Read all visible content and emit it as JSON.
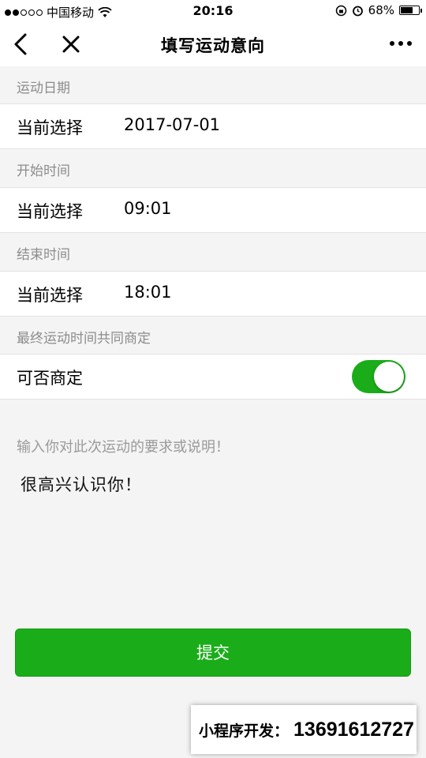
{
  "status_bar": {
    "carrier": "中国移动",
    "time": "20:16",
    "battery_percent_label": "68%",
    "battery_level": 0.68
  },
  "nav": {
    "title": "填写运动意向",
    "icons": [
      "chevron-left-icon",
      "close-icon",
      "more-icon"
    ]
  },
  "sections": [
    {
      "header": "运动日期",
      "label": "当前选择",
      "value": "2017-07-01"
    },
    {
      "header": "开始时间",
      "label": "当前选择",
      "value": "09:01"
    },
    {
      "header": "结束时间",
      "label": "当前选择",
      "value": "18:01"
    }
  ],
  "negotiable": {
    "header": "最终运动时间共同商定",
    "label": "可否商定",
    "enabled": true
  },
  "note": {
    "placeholder": "输入你对此次运动的要求或说明！",
    "value": "很高兴认识你！"
  },
  "submit_label": "提交",
  "watermark": {
    "prefix": "小程序开发：",
    "number": "13691612727"
  },
  "colors": {
    "accent": "#1aad19",
    "background": "#f4f4f4",
    "header_text": "#8c8c8c"
  }
}
